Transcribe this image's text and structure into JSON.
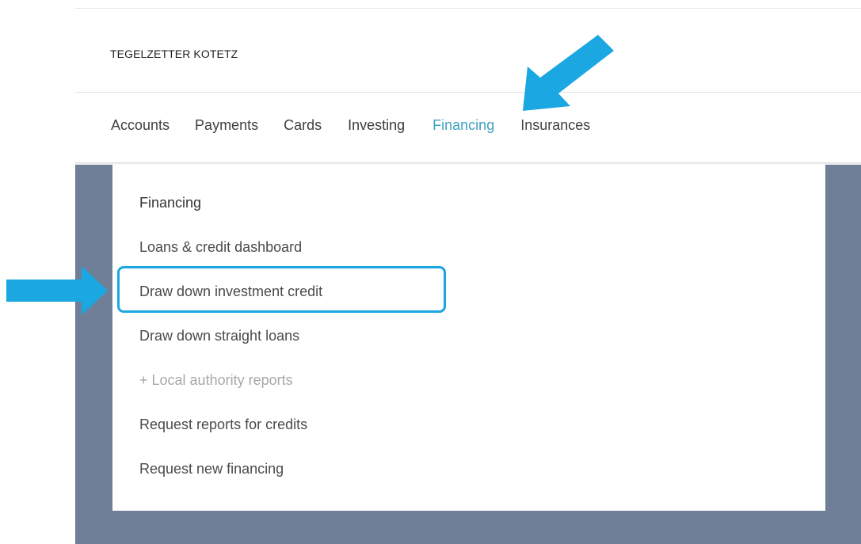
{
  "header": {
    "owner_name": "TEGELZETTER KOTETZ"
  },
  "nav": {
    "tabs": [
      {
        "label": "Accounts"
      },
      {
        "label": "Payments"
      },
      {
        "label": "Cards"
      },
      {
        "label": "Investing"
      },
      {
        "label": "Financing",
        "active": true
      },
      {
        "label": "Insurances"
      }
    ]
  },
  "dropdown": {
    "heading": "Financing",
    "items": [
      {
        "label": "Loans & credit dashboard"
      },
      {
        "label": "Draw down investment credit",
        "highlighted": true
      },
      {
        "label": "Draw down straight loans"
      },
      {
        "label": "+ Local authority reports",
        "muted": true
      },
      {
        "label": "Request reports for credits"
      },
      {
        "label": "Request new financing"
      }
    ]
  },
  "colors": {
    "accent_arrow": "#1aa7e2",
    "active_tab": "#3b9fc1",
    "backdrop": "#6e7f97"
  },
  "annotations": {
    "arrow_left_icon": "arrow-right-icon",
    "arrow_top_icon": "arrow-down-left-icon"
  }
}
